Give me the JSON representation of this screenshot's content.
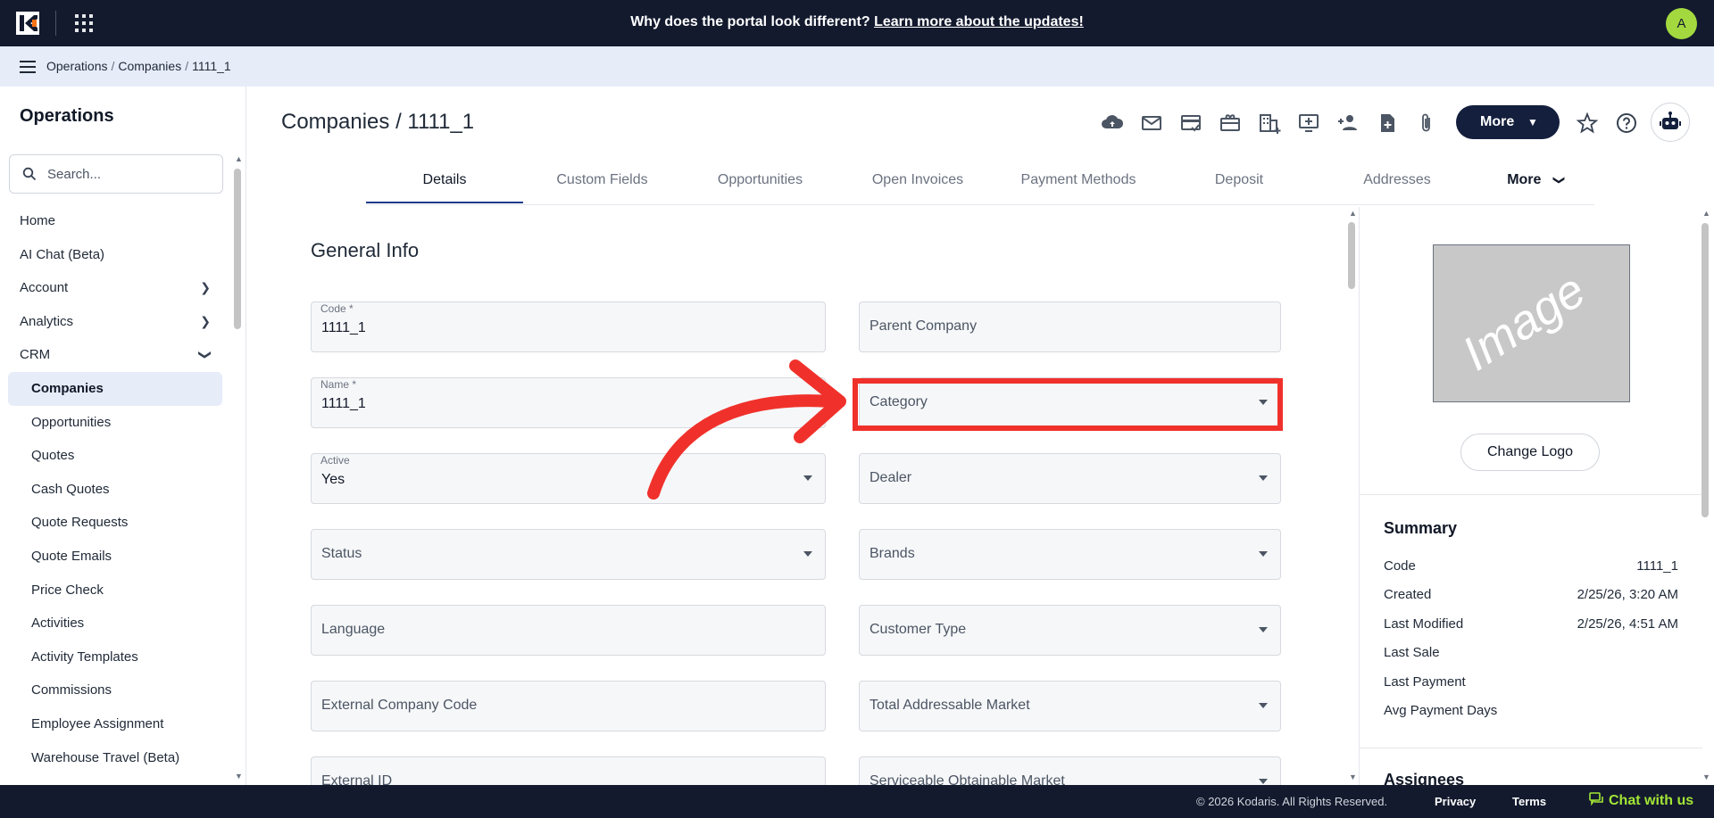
{
  "header": {
    "announcement_text": "Why does the portal look different?",
    "announcement_link": "Learn more about the updates!",
    "avatar_initial": "A"
  },
  "breadcrumb": [
    "Operations",
    "Companies",
    "1111_1"
  ],
  "sidebar": {
    "title": "Operations",
    "search_placeholder": "Search...",
    "items": [
      {
        "label": "Home"
      },
      {
        "label": "AI Chat (Beta)"
      },
      {
        "label": "Account"
      },
      {
        "label": "Analytics"
      },
      {
        "label": "CRM"
      },
      {
        "label": "Companies"
      },
      {
        "label": "Opportunities"
      },
      {
        "label": "Quotes"
      },
      {
        "label": "Cash Quotes"
      },
      {
        "label": "Quote Requests"
      },
      {
        "label": "Quote Emails"
      },
      {
        "label": "Price Check"
      },
      {
        "label": "Activities"
      },
      {
        "label": "Activity Templates"
      },
      {
        "label": "Commissions"
      },
      {
        "label": "Employee Assignment"
      },
      {
        "label": "Warehouse Travel (Beta)"
      }
    ]
  },
  "page": {
    "title": "Companies / 1111_1",
    "more_label": "More"
  },
  "toolbar_icons": [
    "cloud-upload-icon",
    "mail-icon",
    "card-check-icon",
    "gift-card-icon",
    "building-add-icon",
    "screen-add-icon",
    "person-add-icon",
    "file-add-icon",
    "attachment-icon"
  ],
  "tabs": [
    "Details",
    "Custom Fields",
    "Opportunities",
    "Open Invoices",
    "Payment Methods",
    "Deposit",
    "Addresses",
    "More"
  ],
  "form": {
    "section_title": "General Info",
    "code": {
      "label": "Code *",
      "value": "1111_1"
    },
    "parent_company": {
      "placeholder": "Parent Company"
    },
    "name": {
      "label": "Name *",
      "value": "1111_1"
    },
    "category": {
      "placeholder": "Category"
    },
    "active": {
      "label": "Active",
      "value": "Yes"
    },
    "dealer": {
      "placeholder": "Dealer"
    },
    "status": {
      "placeholder": "Status"
    },
    "brands": {
      "placeholder": "Brands"
    },
    "language": {
      "placeholder": "Language"
    },
    "customer_type": {
      "placeholder": "Customer Type"
    },
    "external_company_code": {
      "placeholder": "External Company Code"
    },
    "total_addressable_market": {
      "placeholder": "Total Addressable Market"
    },
    "external_id": {
      "placeholder": "External ID"
    },
    "serviceable_obtainable_market": {
      "placeholder": "Serviceable Obtainable Market"
    }
  },
  "right_panel": {
    "image_placeholder": "Image",
    "change_logo": "Change Logo",
    "summary_title": "Summary",
    "summary": [
      {
        "label": "Code",
        "value": "1111_1"
      },
      {
        "label": "Created",
        "value": "2/25/26, 3:20 AM"
      },
      {
        "label": "Last Modified",
        "value": "2/25/26, 4:51 AM"
      },
      {
        "label": "Last Sale",
        "value": ""
      },
      {
        "label": "Last Payment",
        "value": ""
      },
      {
        "label": "Avg Payment Days",
        "value": ""
      }
    ],
    "assignees_title": "Assignees"
  },
  "footer": {
    "copyright": "© 2026 Kodaris. All Rights Reserved.",
    "privacy": "Privacy",
    "terms": "Terms",
    "chat": "Chat with us"
  },
  "colors": {
    "topbar": "#131a2e",
    "accent": "#1e3a8a",
    "highlight": "#f0312b",
    "avatar": "#a3d93f"
  }
}
